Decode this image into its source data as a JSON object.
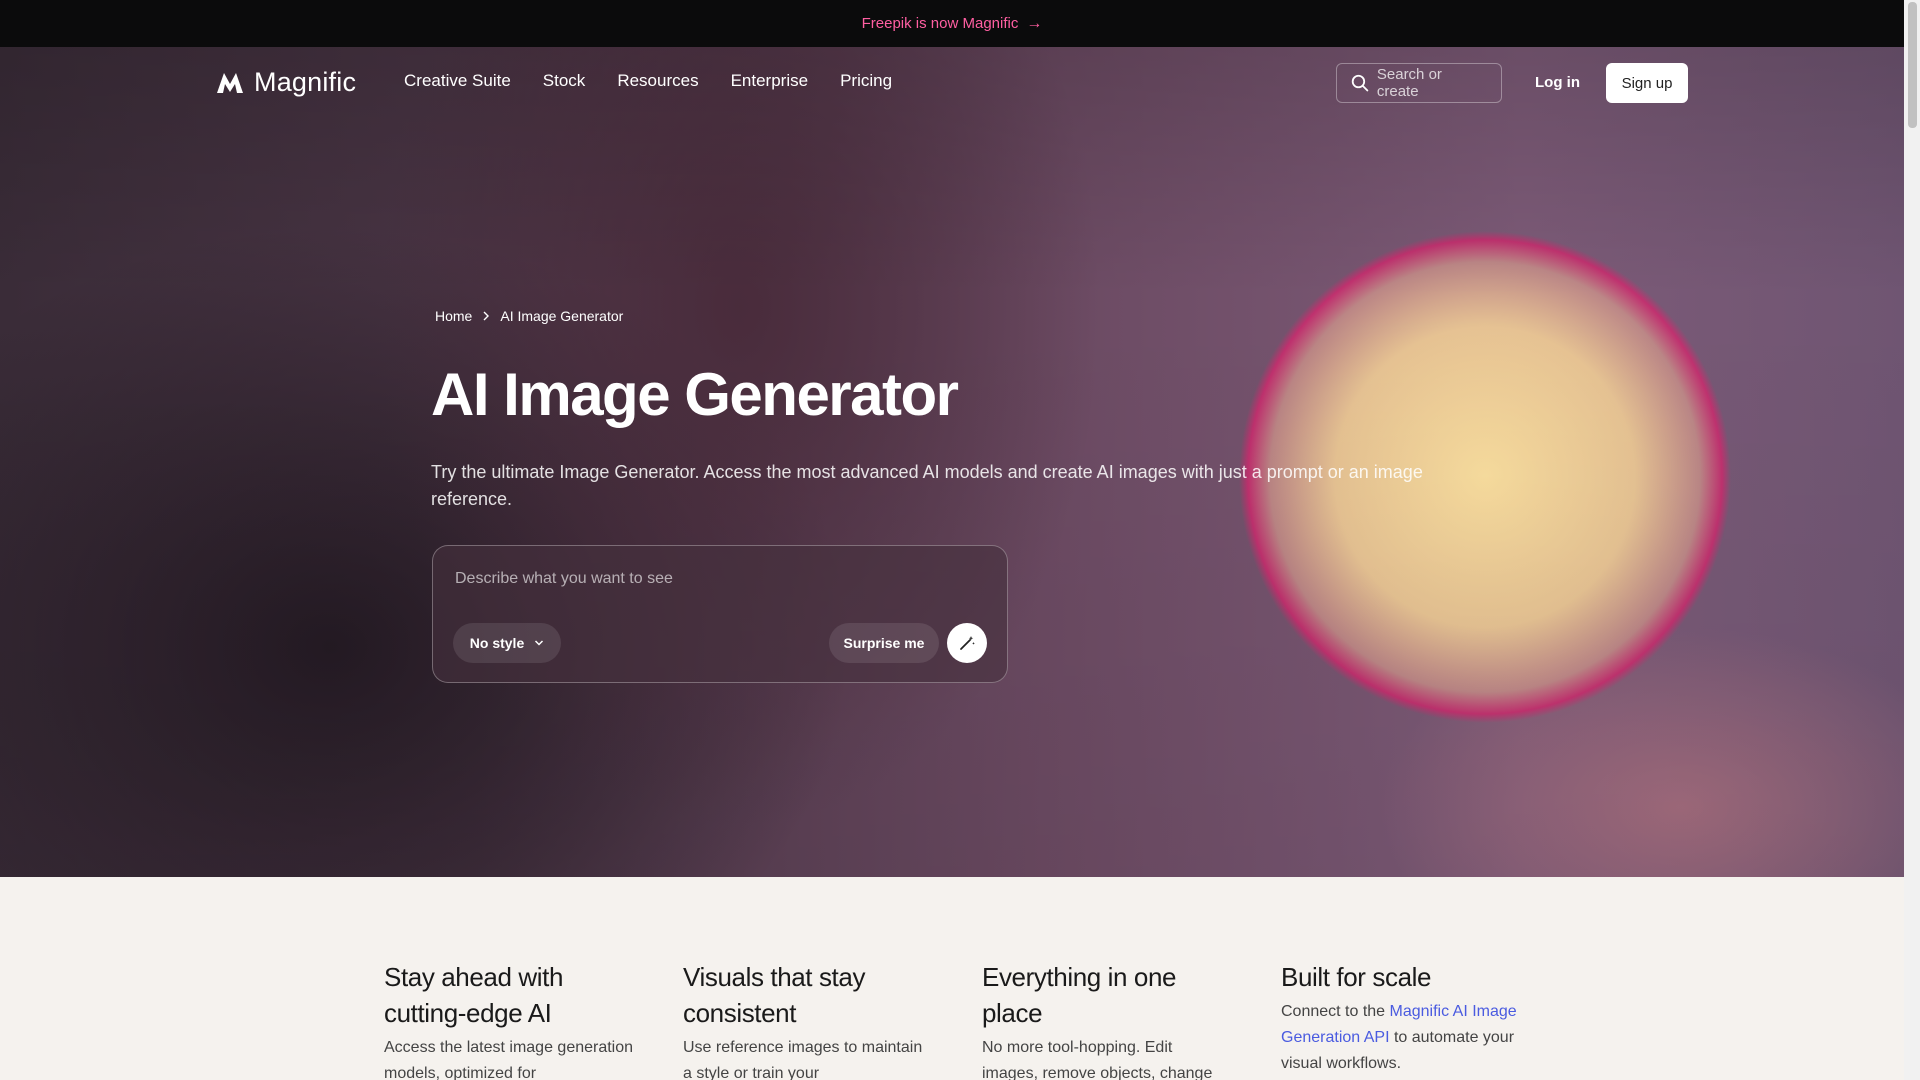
{
  "announcement": {
    "text": "Freepik is now Magnific",
    "arrow": "→"
  },
  "nav": {
    "logo": "Magnific",
    "links": [
      "Creative Suite",
      "Stock",
      "Resources",
      "Enterprise",
      "Pricing"
    ],
    "search_placeholder": "Search or create",
    "login": "Log in",
    "signup": "Sign up"
  },
  "breadcrumb": {
    "home": "Home",
    "current": "AI Image Generator"
  },
  "hero": {
    "title": "AI Image Generator",
    "subtitle": "Try the ultimate Image Generator. Access the most advanced AI models and create AI images with just a prompt or an image reference."
  },
  "prompt": {
    "placeholder": "Describe what you want to see",
    "style": "No style",
    "surprise": "Surprise me"
  },
  "features": [
    {
      "title": "Stay ahead with cutting-edge AI",
      "text": "Access the latest image generation models, optimized for"
    },
    {
      "title": "Visuals that stay consistent",
      "text": "Use reference images to maintain a style or train your"
    },
    {
      "title": "Everything in one place",
      "text": "No more tool-hopping. Edit images, remove objects, change"
    },
    {
      "title": "Built for scale",
      "text_before": "Connect to the ",
      "link": "Magnific AI Image Generation API",
      "text_after": " to automate your visual workflows."
    }
  ],
  "colors": {
    "accent": "#ff5fa2",
    "link": "#4a5be0",
    "announce_bg": "#0b0b0c"
  }
}
